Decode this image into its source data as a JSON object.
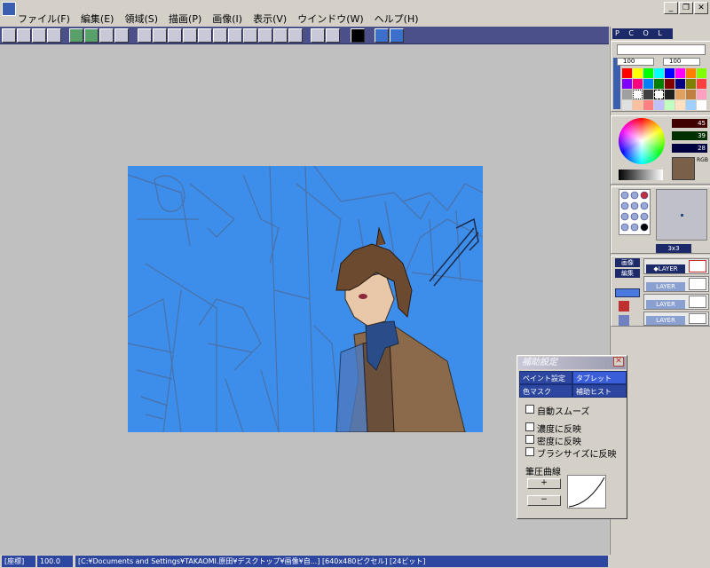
{
  "menu": {
    "items": [
      "ファイル(F)",
      "編集(E)",
      "領域(S)",
      "描画(P)",
      "画像(I)",
      "表示(V)",
      "ウインドウ(W)",
      "ヘルプ(H)"
    ]
  },
  "window_controls": {
    "minimize": "_",
    "restore": "❐",
    "close": "✕"
  },
  "panel": {
    "pcol_label": "P C O L",
    "brush_values": [
      "100",
      "100"
    ],
    "rgb_values": [
      "45",
      "39",
      "28"
    ],
    "rgb_mode": "RGB",
    "brush_size": "3x3",
    "layer_buttons": [
      "画像",
      "編集"
    ],
    "layer_name": "◆LAYER",
    "layer_other": "LAYER"
  },
  "dialog": {
    "title": "補助設定",
    "close": "✕",
    "tabs": [
      "ペイント設定",
      "タブレット",
      "色マスク",
      "補助ヒスト"
    ],
    "auto_smooth": "自動スムーズ",
    "checks": [
      "濃度に反映",
      "密度に反映",
      "ブラシサイズに反映"
    ],
    "pressure_label": "筆圧曲線",
    "plus": "+",
    "minus": "−"
  },
  "status": {
    "mode": "[座標]",
    "zoom": "100.0",
    "path": "[C:¥Documents and Settings¥TAKAOMI.原田¥デスクトップ¥画像¥自...]  [640x480ピクセル]  [24ビット]"
  },
  "colors": {
    "accent": "#2d47a0",
    "canvas_bg": "#3d8eea",
    "toolbar_bg": "#4b4f8a"
  }
}
